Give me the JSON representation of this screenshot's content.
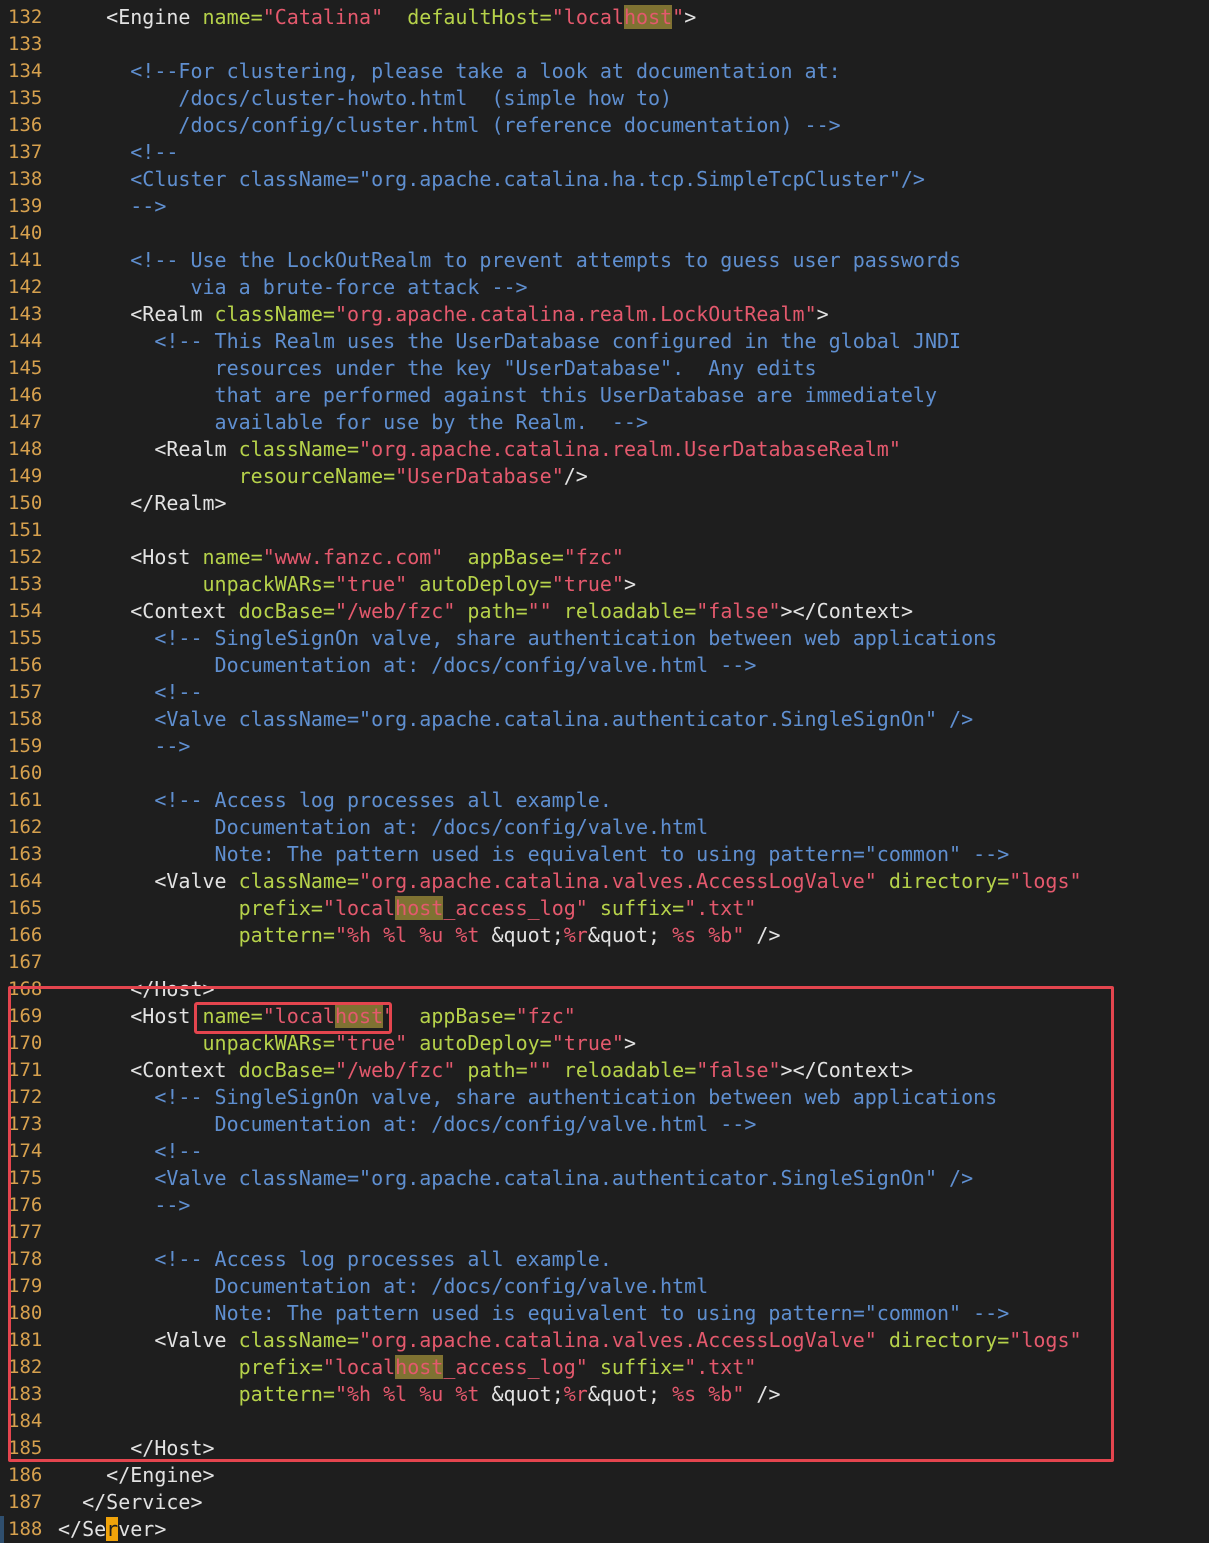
{
  "editor": {
    "lines": [
      {
        "no": "132",
        "segs": [
          {
            "t": "    ",
            "c": "txt"
          },
          {
            "t": "<Engine ",
            "c": "tag"
          },
          {
            "t": "name=",
            "c": "attr"
          },
          {
            "t": "\"Catalina\"",
            "c": "str"
          },
          {
            "t": "  ",
            "c": "txt"
          },
          {
            "t": "defaultHost=",
            "c": "attr"
          },
          {
            "t": "\"local",
            "c": "str"
          },
          {
            "t": "host",
            "c": "str hl"
          },
          {
            "t": "\"",
            "c": "str"
          },
          {
            "t": ">",
            "c": "tag"
          }
        ]
      },
      {
        "no": "133",
        "segs": []
      },
      {
        "no": "134",
        "segs": [
          {
            "t": "      <!--For clustering, please take a look at documentation at:",
            "c": "cmt"
          }
        ]
      },
      {
        "no": "135",
        "segs": [
          {
            "t": "          /docs/cluster-howto.html  (simple how to)",
            "c": "cmt"
          }
        ]
      },
      {
        "no": "136",
        "segs": [
          {
            "t": "          /docs/config/cluster.html (reference documentation) -->",
            "c": "cmt"
          }
        ]
      },
      {
        "no": "137",
        "segs": [
          {
            "t": "      <!--",
            "c": "cmt"
          }
        ]
      },
      {
        "no": "138",
        "segs": [
          {
            "t": "      <Cluster className=\"org.apache.catalina.ha.tcp.SimpleTcpCluster\"/>",
            "c": "cmt"
          }
        ]
      },
      {
        "no": "139",
        "segs": [
          {
            "t": "      -->",
            "c": "cmt"
          }
        ]
      },
      {
        "no": "140",
        "segs": []
      },
      {
        "no": "141",
        "segs": [
          {
            "t": "      <!-- Use the LockOutRealm to prevent attempts to guess user passwords",
            "c": "cmt"
          }
        ]
      },
      {
        "no": "142",
        "segs": [
          {
            "t": "           via a brute-force attack -->",
            "c": "cmt"
          }
        ]
      },
      {
        "no": "143",
        "segs": [
          {
            "t": "      ",
            "c": "txt"
          },
          {
            "t": "<Realm ",
            "c": "tag"
          },
          {
            "t": "className=",
            "c": "attr"
          },
          {
            "t": "\"org.apache.catalina.realm.LockOutRealm\"",
            "c": "str"
          },
          {
            "t": ">",
            "c": "tag"
          }
        ]
      },
      {
        "no": "144",
        "segs": [
          {
            "t": "        <!-- This Realm uses the UserDatabase configured in the global JNDI",
            "c": "cmt"
          }
        ]
      },
      {
        "no": "145",
        "segs": [
          {
            "t": "             resources under the key \"UserDatabase\".  Any edits",
            "c": "cmt"
          }
        ]
      },
      {
        "no": "146",
        "segs": [
          {
            "t": "             that are performed against this UserDatabase are immediately",
            "c": "cmt"
          }
        ]
      },
      {
        "no": "147",
        "segs": [
          {
            "t": "             available for use by the Realm.  -->",
            "c": "cmt"
          }
        ]
      },
      {
        "no": "148",
        "segs": [
          {
            "t": "        ",
            "c": "txt"
          },
          {
            "t": "<Realm ",
            "c": "tag"
          },
          {
            "t": "className=",
            "c": "attr"
          },
          {
            "t": "\"org.apache.catalina.realm.UserDatabaseRealm\"",
            "c": "str"
          }
        ]
      },
      {
        "no": "149",
        "segs": [
          {
            "t": "               ",
            "c": "txt"
          },
          {
            "t": "resourceName=",
            "c": "attr"
          },
          {
            "t": "\"UserDatabase\"",
            "c": "str"
          },
          {
            "t": "/>",
            "c": "tag"
          }
        ]
      },
      {
        "no": "150",
        "segs": [
          {
            "t": "      ",
            "c": "txt"
          },
          {
            "t": "</Realm>",
            "c": "tag"
          }
        ]
      },
      {
        "no": "151",
        "segs": []
      },
      {
        "no": "152",
        "segs": [
          {
            "t": "      ",
            "c": "txt"
          },
          {
            "t": "<Host ",
            "c": "tag"
          },
          {
            "t": "name=",
            "c": "attr"
          },
          {
            "t": "\"www.fanzc.com\"",
            "c": "str"
          },
          {
            "t": "  ",
            "c": "txt"
          },
          {
            "t": "appBase=",
            "c": "attr"
          },
          {
            "t": "\"fzc\"",
            "c": "str"
          }
        ]
      },
      {
        "no": "153",
        "segs": [
          {
            "t": "            ",
            "c": "txt"
          },
          {
            "t": "unpackWARs=",
            "c": "attr"
          },
          {
            "t": "\"true\"",
            "c": "str"
          },
          {
            "t": " ",
            "c": "txt"
          },
          {
            "t": "autoDeploy=",
            "c": "attr"
          },
          {
            "t": "\"true\"",
            "c": "str"
          },
          {
            "t": ">",
            "c": "tag"
          }
        ]
      },
      {
        "no": "154",
        "segs": [
          {
            "t": "      ",
            "c": "txt"
          },
          {
            "t": "<Context ",
            "c": "tag"
          },
          {
            "t": "docBase=",
            "c": "attr"
          },
          {
            "t": "\"/web/fzc\"",
            "c": "str"
          },
          {
            "t": " ",
            "c": "txt"
          },
          {
            "t": "path=",
            "c": "attr"
          },
          {
            "t": "\"\"",
            "c": "str"
          },
          {
            "t": " ",
            "c": "txt"
          },
          {
            "t": "reloadable=",
            "c": "attr"
          },
          {
            "t": "\"false\"",
            "c": "str"
          },
          {
            "t": "></Context>",
            "c": "tag"
          }
        ]
      },
      {
        "no": "155",
        "segs": [
          {
            "t": "        <!-- SingleSignOn valve, share authentication between web applications",
            "c": "cmt"
          }
        ]
      },
      {
        "no": "156",
        "segs": [
          {
            "t": "             Documentation at: /docs/config/valve.html -->",
            "c": "cmt"
          }
        ]
      },
      {
        "no": "157",
        "segs": [
          {
            "t": "        <!--",
            "c": "cmt"
          }
        ]
      },
      {
        "no": "158",
        "segs": [
          {
            "t": "        <Valve className=\"org.apache.catalina.authenticator.SingleSignOn\" />",
            "c": "cmt"
          }
        ]
      },
      {
        "no": "159",
        "segs": [
          {
            "t": "        -->",
            "c": "cmt"
          }
        ]
      },
      {
        "no": "160",
        "segs": []
      },
      {
        "no": "161",
        "segs": [
          {
            "t": "        <!-- Access log processes all example.",
            "c": "cmt"
          }
        ]
      },
      {
        "no": "162",
        "segs": [
          {
            "t": "             Documentation at: /docs/config/valve.html",
            "c": "cmt"
          }
        ]
      },
      {
        "no": "163",
        "segs": [
          {
            "t": "             Note: The pattern used is equivalent to using pattern=\"common\" -->",
            "c": "cmt"
          }
        ]
      },
      {
        "no": "164",
        "segs": [
          {
            "t": "        ",
            "c": "txt"
          },
          {
            "t": "<Valve ",
            "c": "tag"
          },
          {
            "t": "className=",
            "c": "attr"
          },
          {
            "t": "\"org.apache.catalina.valves.AccessLogValve\"",
            "c": "str"
          },
          {
            "t": " ",
            "c": "txt"
          },
          {
            "t": "directory=",
            "c": "attr"
          },
          {
            "t": "\"logs\"",
            "c": "str"
          }
        ]
      },
      {
        "no": "165",
        "segs": [
          {
            "t": "               ",
            "c": "txt"
          },
          {
            "t": "prefix=",
            "c": "attr"
          },
          {
            "t": "\"local",
            "c": "str"
          },
          {
            "t": "host",
            "c": "str hl"
          },
          {
            "t": "_access_log\"",
            "c": "str"
          },
          {
            "t": " ",
            "c": "txt"
          },
          {
            "t": "suffix=",
            "c": "attr"
          },
          {
            "t": "\".txt\"",
            "c": "str"
          }
        ]
      },
      {
        "no": "166",
        "segs": [
          {
            "t": "               ",
            "c": "txt"
          },
          {
            "t": "pattern=",
            "c": "attr"
          },
          {
            "t": "\"%h %l %u %t ",
            "c": "str"
          },
          {
            "t": "&quot;",
            "c": "txt"
          },
          {
            "t": "%r",
            "c": "str"
          },
          {
            "t": "&quot;",
            "c": "txt"
          },
          {
            "t": " %s %b\"",
            "c": "str"
          },
          {
            "t": " />",
            "c": "tag"
          }
        ]
      },
      {
        "no": "167",
        "segs": []
      },
      {
        "no": "168",
        "segs": [
          {
            "t": "      ",
            "c": "txt"
          },
          {
            "t": "</Host>",
            "c": "tag"
          }
        ]
      },
      {
        "no": "169",
        "segs": [
          {
            "t": "      ",
            "c": "txt"
          },
          {
            "t": "<Host ",
            "c": "tag"
          },
          {
            "t": "name=",
            "c": "attr"
          },
          {
            "t": "\"local",
            "c": "str"
          },
          {
            "t": "host",
            "c": "str hl"
          },
          {
            "t": "\"",
            "c": "str"
          },
          {
            "t": "  ",
            "c": "txt"
          },
          {
            "t": "appBase=",
            "c": "attr"
          },
          {
            "t": "\"fzc\"",
            "c": "str"
          }
        ]
      },
      {
        "no": "170",
        "segs": [
          {
            "t": "            ",
            "c": "txt"
          },
          {
            "t": "unpackWARs=",
            "c": "attr"
          },
          {
            "t": "\"true\"",
            "c": "str"
          },
          {
            "t": " ",
            "c": "txt"
          },
          {
            "t": "autoDeploy=",
            "c": "attr"
          },
          {
            "t": "\"true\"",
            "c": "str"
          },
          {
            "t": ">",
            "c": "tag"
          }
        ]
      },
      {
        "no": "171",
        "segs": [
          {
            "t": "      ",
            "c": "txt"
          },
          {
            "t": "<Context ",
            "c": "tag"
          },
          {
            "t": "docBase=",
            "c": "attr"
          },
          {
            "t": "\"/web/fzc\"",
            "c": "str"
          },
          {
            "t": " ",
            "c": "txt"
          },
          {
            "t": "path=",
            "c": "attr"
          },
          {
            "t": "\"\"",
            "c": "str"
          },
          {
            "t": " ",
            "c": "txt"
          },
          {
            "t": "reloadable=",
            "c": "attr"
          },
          {
            "t": "\"false\"",
            "c": "str"
          },
          {
            "t": "></Context>",
            "c": "tag"
          }
        ]
      },
      {
        "no": "172",
        "segs": [
          {
            "t": "        <!-- SingleSignOn valve, share authentication between web applications",
            "c": "cmt"
          }
        ]
      },
      {
        "no": "173",
        "segs": [
          {
            "t": "             Documentation at: /docs/config/valve.html -->",
            "c": "cmt"
          }
        ]
      },
      {
        "no": "174",
        "segs": [
          {
            "t": "        <!--",
            "c": "cmt"
          }
        ]
      },
      {
        "no": "175",
        "segs": [
          {
            "t": "        <Valve className=\"org.apache.catalina.authenticator.SingleSignOn\" />",
            "c": "cmt"
          }
        ]
      },
      {
        "no": "176",
        "segs": [
          {
            "t": "        -->",
            "c": "cmt"
          }
        ]
      },
      {
        "no": "177",
        "segs": []
      },
      {
        "no": "178",
        "segs": [
          {
            "t": "        <!-- Access log processes all example.",
            "c": "cmt"
          }
        ]
      },
      {
        "no": "179",
        "segs": [
          {
            "t": "             Documentation at: /docs/config/valve.html",
            "c": "cmt"
          }
        ]
      },
      {
        "no": "180",
        "segs": [
          {
            "t": "             Note: The pattern used is equivalent to using pattern=\"common\" -->",
            "c": "cmt"
          }
        ]
      },
      {
        "no": "181",
        "segs": [
          {
            "t": "        ",
            "c": "txt"
          },
          {
            "t": "<Valve ",
            "c": "tag"
          },
          {
            "t": "className=",
            "c": "attr"
          },
          {
            "t": "\"org.apache.catalina.valves.AccessLogValve\"",
            "c": "str"
          },
          {
            "t": " ",
            "c": "txt"
          },
          {
            "t": "directory=",
            "c": "attr"
          },
          {
            "t": "\"logs\"",
            "c": "str"
          }
        ]
      },
      {
        "no": "182",
        "segs": [
          {
            "t": "               ",
            "c": "txt"
          },
          {
            "t": "prefix=",
            "c": "attr"
          },
          {
            "t": "\"local",
            "c": "str"
          },
          {
            "t": "host",
            "c": "str hl"
          },
          {
            "t": "_access_log\"",
            "c": "str"
          },
          {
            "t": " ",
            "c": "txt"
          },
          {
            "t": "suffix=",
            "c": "attr"
          },
          {
            "t": "\".txt\"",
            "c": "str"
          }
        ]
      },
      {
        "no": "183",
        "segs": [
          {
            "t": "               ",
            "c": "txt"
          },
          {
            "t": "pattern=",
            "c": "attr"
          },
          {
            "t": "\"%h %l %u %t ",
            "c": "str"
          },
          {
            "t": "&quot;",
            "c": "txt"
          },
          {
            "t": "%r",
            "c": "str"
          },
          {
            "t": "&quot;",
            "c": "txt"
          },
          {
            "t": " %s %b\"",
            "c": "str"
          },
          {
            "t": " />",
            "c": "tag"
          }
        ]
      },
      {
        "no": "184",
        "segs": []
      },
      {
        "no": "185",
        "segs": [
          {
            "t": "      ",
            "c": "txt"
          },
          {
            "t": "</Host>",
            "c": "tag"
          }
        ]
      },
      {
        "no": "186",
        "segs": [
          {
            "t": "    ",
            "c": "txt"
          },
          {
            "t": "</Engine>",
            "c": "tag"
          }
        ]
      },
      {
        "no": "187",
        "segs": [
          {
            "t": "  ",
            "c": "txt"
          },
          {
            "t": "</Service>",
            "c": "tag"
          }
        ]
      },
      {
        "no": "188",
        "segs": [
          {
            "t": "</Se",
            "c": "tag"
          },
          {
            "t": "r",
            "c": "tag cursor"
          },
          {
            "t": "ver>",
            "c": "tag"
          }
        ]
      }
    ]
  },
  "colors": {
    "background": "#1e1e1e",
    "line_number": "#d7a14e",
    "tag": "#e2e2e2",
    "attribute": "#b6d24a",
    "string": "#e4596d",
    "comment": "#5f8fd0",
    "search_highlight": "#7f7232",
    "cursor": "#f0a30a",
    "annotation_box": "#e4454e"
  }
}
